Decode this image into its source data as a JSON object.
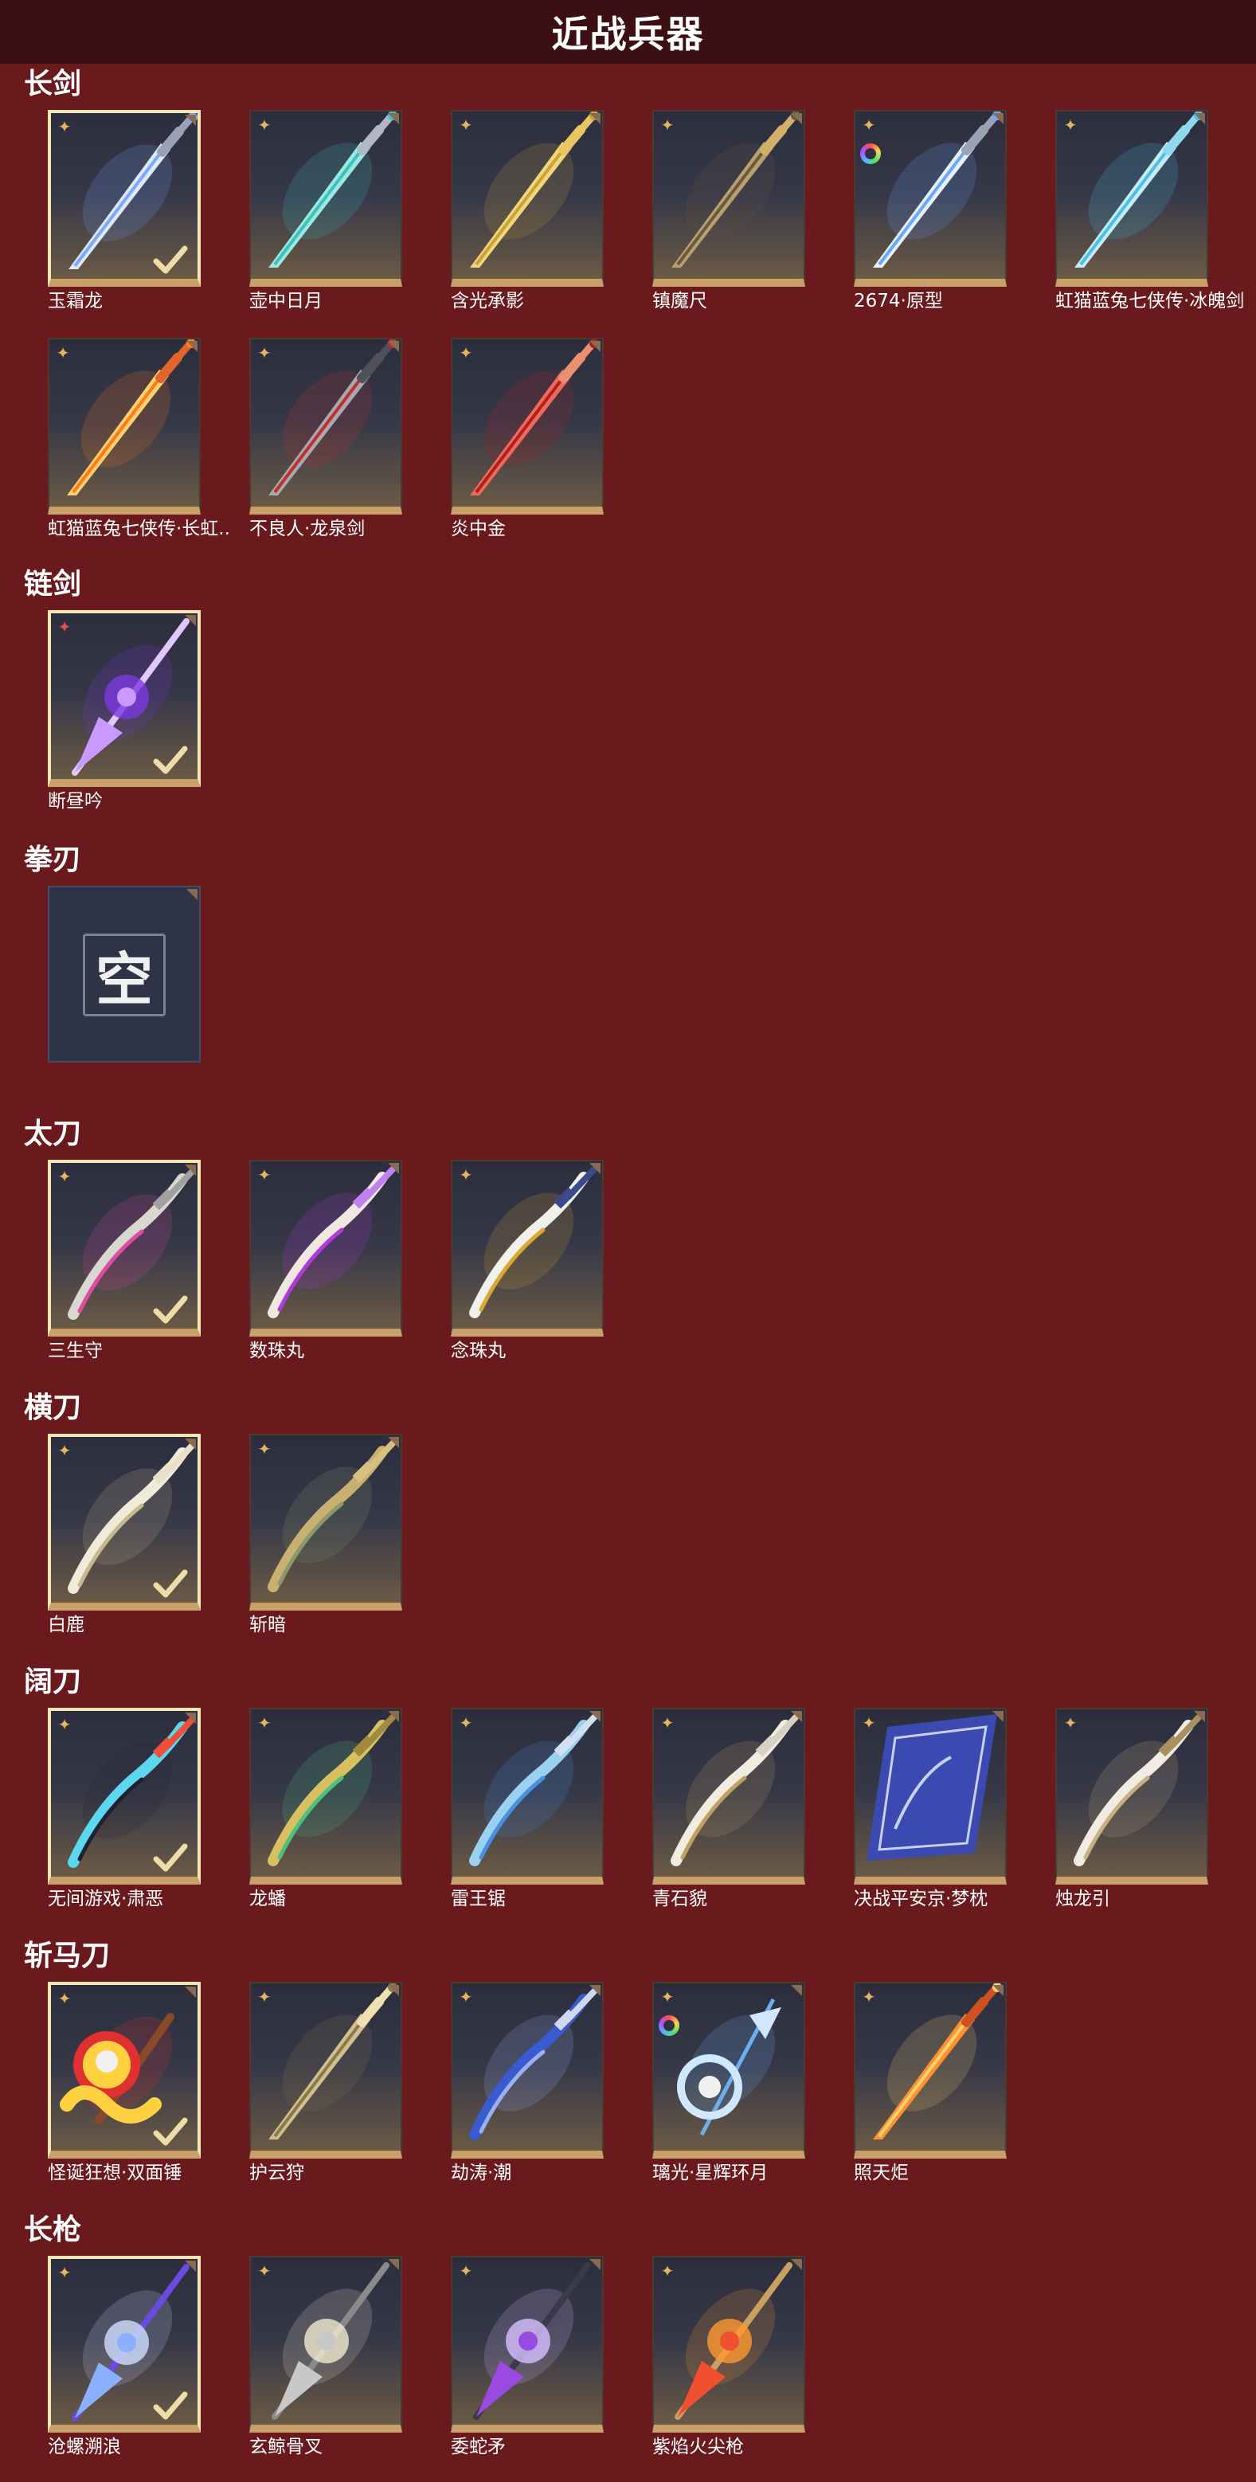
{
  "page": {
    "title": "近战兵器"
  },
  "sections": [
    {
      "name": "长剑",
      "items": [
        {
          "name": "玉霜龙",
          "equipped": true,
          "badge": "star",
          "art": "sword-ice-blue"
        },
        {
          "name": "壶中日月",
          "equipped": false,
          "badge": "star",
          "art": "sword-teal"
        },
        {
          "name": "含光承影",
          "equipped": false,
          "badge": "star",
          "art": "sword-gold"
        },
        {
          "name": "镇魔尺",
          "equipped": false,
          "badge": "star",
          "art": "sword-dark-gold"
        },
        {
          "name": "2674·原型",
          "equipped": false,
          "badge": "star",
          "rainbow": true,
          "art": "sword-light-saber"
        },
        {
          "name": "虹猫蓝兔七侠传·冰魄剑",
          "equipped": false,
          "badge": "star",
          "art": "sword-ice-cyan"
        },
        {
          "name": "虹猫蓝兔七侠传·长虹剑",
          "display": "虹猫蓝兔七侠传·长虹..",
          "equipped": false,
          "badge": "star",
          "art": "sword-flame"
        },
        {
          "name": "不良人·龙泉剑",
          "equipped": false,
          "badge": "star",
          "art": "sword-dark-red"
        },
        {
          "name": "炎中金",
          "equipped": false,
          "badge": "star",
          "art": "sword-red-crystal"
        }
      ]
    },
    {
      "name": "链剑",
      "items": [
        {
          "name": "断昼吟",
          "equipped": true,
          "badge": "red-star",
          "art": "chain-purple"
        }
      ]
    },
    {
      "name": "拳刃",
      "items": [
        {
          "name": "",
          "empty": true,
          "empty_label": "空"
        }
      ]
    },
    {
      "name": "太刀",
      "items": [
        {
          "name": "三生守",
          "equipped": true,
          "badge": "star",
          "art": "katana-silver"
        },
        {
          "name": "数珠丸",
          "equipped": false,
          "badge": "star",
          "art": "katana-purple"
        },
        {
          "name": "念珠丸",
          "equipped": false,
          "badge": "star",
          "art": "katana-gold"
        }
      ]
    },
    {
      "name": "横刀",
      "items": [
        {
          "name": "白鹿",
          "equipped": true,
          "badge": "star",
          "art": "hengdao-white"
        },
        {
          "name": "斩暗",
          "equipped": false,
          "badge": "star",
          "art": "hengdao-gold"
        }
      ]
    },
    {
      "name": "阔刀",
      "items": [
        {
          "name": "无间游戏·肃恶",
          "equipped": true,
          "badge": "star",
          "art": "broad-cyan"
        },
        {
          "name": "龙蟠",
          "equipped": false,
          "badge": "star",
          "art": "broad-gold-green"
        },
        {
          "name": "雷王锯",
          "equipped": false,
          "badge": "star",
          "art": "broad-blue"
        },
        {
          "name": "青石貌",
          "equipped": false,
          "badge": "star",
          "art": "broad-white-gold"
        },
        {
          "name": "决战平安京·梦枕",
          "equipped": false,
          "badge": "star",
          "art": "broad-banner"
        },
        {
          "name": "烛龙引",
          "equipped": false,
          "badge": "star",
          "art": "broad-dragon"
        }
      ]
    },
    {
      "name": "斩马刀",
      "items": [
        {
          "name": "怪诞狂想·双面锤",
          "equipped": true,
          "badge": "star",
          "art": "hammer-clown"
        },
        {
          "name": "护云狩",
          "equipped": false,
          "badge": "star",
          "art": "zhanma-gold"
        },
        {
          "name": "劫涛·潮",
          "equipped": false,
          "badge": "star",
          "art": "zhanma-curve-blue"
        },
        {
          "name": "璃光·星辉环月",
          "equipped": false,
          "badge": "star",
          "rainbow": true,
          "art": "zhanma-moon"
        },
        {
          "name": "照天炬",
          "equipped": false,
          "badge": "star",
          "art": "zhanma-flame"
        }
      ]
    },
    {
      "name": "长枪",
      "items": [
        {
          "name": "沧螺溯浪",
          "equipped": true,
          "badge": "star",
          "art": "spear-blue"
        },
        {
          "name": "玄鲸骨叉",
          "equipped": false,
          "badge": "star",
          "art": "spear-silver"
        },
        {
          "name": "委蛇矛",
          "equipped": false,
          "badge": "star",
          "art": "spear-purple"
        },
        {
          "name": "紫焰火尖枪",
          "equipped": false,
          "badge": "star",
          "art": "spear-fire"
        }
      ]
    }
  ],
  "colors": {
    "background": "#6a191d",
    "header": "#3c0f12",
    "card_bottom": "#c9a06a",
    "equipped_border": "#f5e6b8",
    "badge_gold": "#e6b45a"
  },
  "art_palettes": {
    "sword-ice-blue": [
      "#dfe8f5",
      "#7aa8ff",
      "#9aa3b5"
    ],
    "sword-teal": [
      "#9fe8e0",
      "#3cc1c1",
      "#b0b8c4"
    ],
    "sword-gold": [
      "#f2d77a",
      "#c9a23c",
      "#e8c760"
    ],
    "sword-dark-gold": [
      "#b8a070",
      "#6a5a40",
      "#d2b06a"
    ],
    "sword-light-saber": [
      "#e8f2ff",
      "#6aa8ff",
      "#9aa3b5"
    ],
    "sword-ice-cyan": [
      "#c8ecf5",
      "#4ac0e8",
      "#8fd8f0"
    ],
    "sword-flame": [
      "#ffd070",
      "#ff7a1a",
      "#e0642c"
    ],
    "sword-dark-red": [
      "#a8a8b0",
      "#c0302c",
      "#505058"
    ],
    "sword-red-crystal": [
      "#f06a5a",
      "#b0201e",
      "#e89070"
    ],
    "chain-purple": [
      "#c89aff",
      "#7a3ae0",
      "#e0c8ff"
    ],
    "katana-silver": [
      "#d8d8d0",
      "#e04aa0",
      "#a0a0a0"
    ],
    "katana-purple": [
      "#f0e8e0",
      "#b03ad8",
      "#c080f0"
    ],
    "katana-gold": [
      "#f0f0ec",
      "#d8a830",
      "#3a4a8a"
    ],
    "hengdao-white": [
      "#f0ead8",
      "#c8b890",
      "#e8e0c8"
    ],
    "hengdao-gold": [
      "#c8b070",
      "#8a9a6a",
      "#d8c080"
    ],
    "broad-cyan": [
      "#5ad8f0",
      "#202030",
      "#f0503a"
    ],
    "broad-gold-green": [
      "#d8c060",
      "#50c080",
      "#a08a40"
    ],
    "broad-blue": [
      "#9ad0f0",
      "#4a90e0",
      "#d0e0f0"
    ],
    "broad-white-gold": [
      "#f0ece0",
      "#c0a060",
      "#d8d0c0"
    ],
    "broad-banner": [
      "#3a4ab0",
      "#c8d0f0",
      "#2a3a90"
    ],
    "broad-dragon": [
      "#f0ece4",
      "#c8b080",
      "#a89060"
    ],
    "hammer-clown": [
      "#ffd040",
      "#e03030",
      "#f0f0f0"
    ],
    "zhanma-gold": [
      "#d0c090",
      "#8a7a4a",
      "#f0e0b0"
    ],
    "zhanma-curve-blue": [
      "#3a5ad0",
      "#9ab0f0",
      "#d0d8f0"
    ],
    "zhanma-moon": [
      "#d0e8ff",
      "#6ab0f0",
      "#f0f0f0"
    ],
    "zhanma-flame": [
      "#ff9030",
      "#ffd070",
      "#d05020"
    ],
    "spear-blue": [
      "#8ab0ff",
      "#d0e0ff",
      "#6a4ae0"
    ],
    "spear-silver": [
      "#c8c8c8",
      "#f0e8d0",
      "#8a8a8a"
    ],
    "spear-purple": [
      "#9a4ae0",
      "#d8c0ff",
      "#3a3a4a"
    ],
    "spear-fire": [
      "#f05030",
      "#ff9a30",
      "#c8a060"
    ]
  }
}
